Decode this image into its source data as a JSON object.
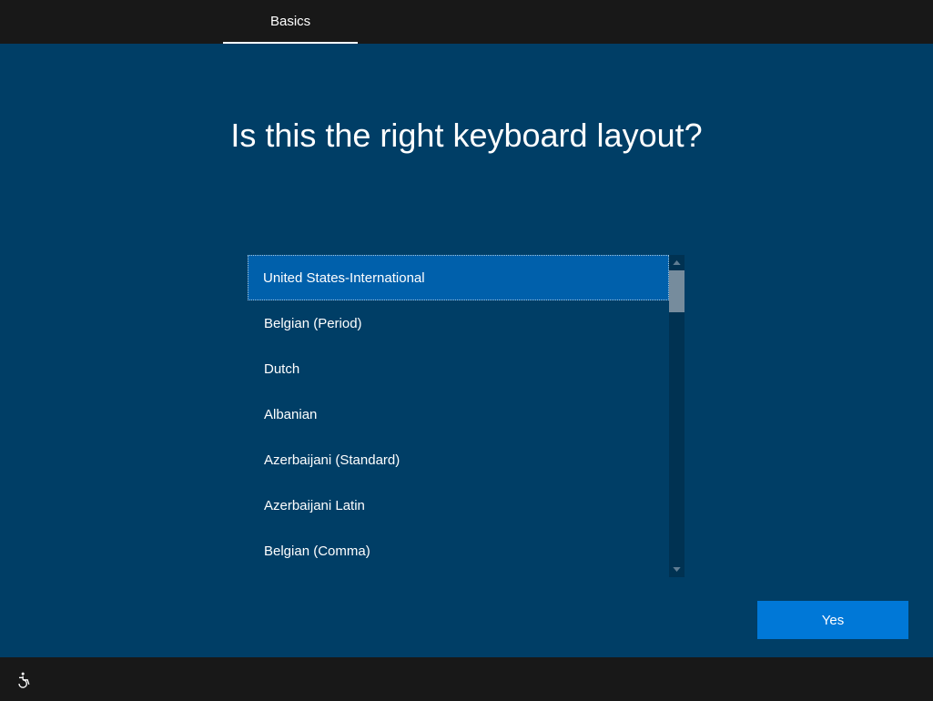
{
  "header": {
    "tab": "Basics"
  },
  "main": {
    "title": "Is this the right keyboard layout?",
    "items": [
      "United States-International",
      "Belgian (Period)",
      "Dutch",
      "Albanian",
      "Azerbaijani (Standard)",
      "Azerbaijani Latin",
      "Belgian (Comma)"
    ],
    "selectedIndex": 0,
    "confirmLabel": "Yes"
  }
}
